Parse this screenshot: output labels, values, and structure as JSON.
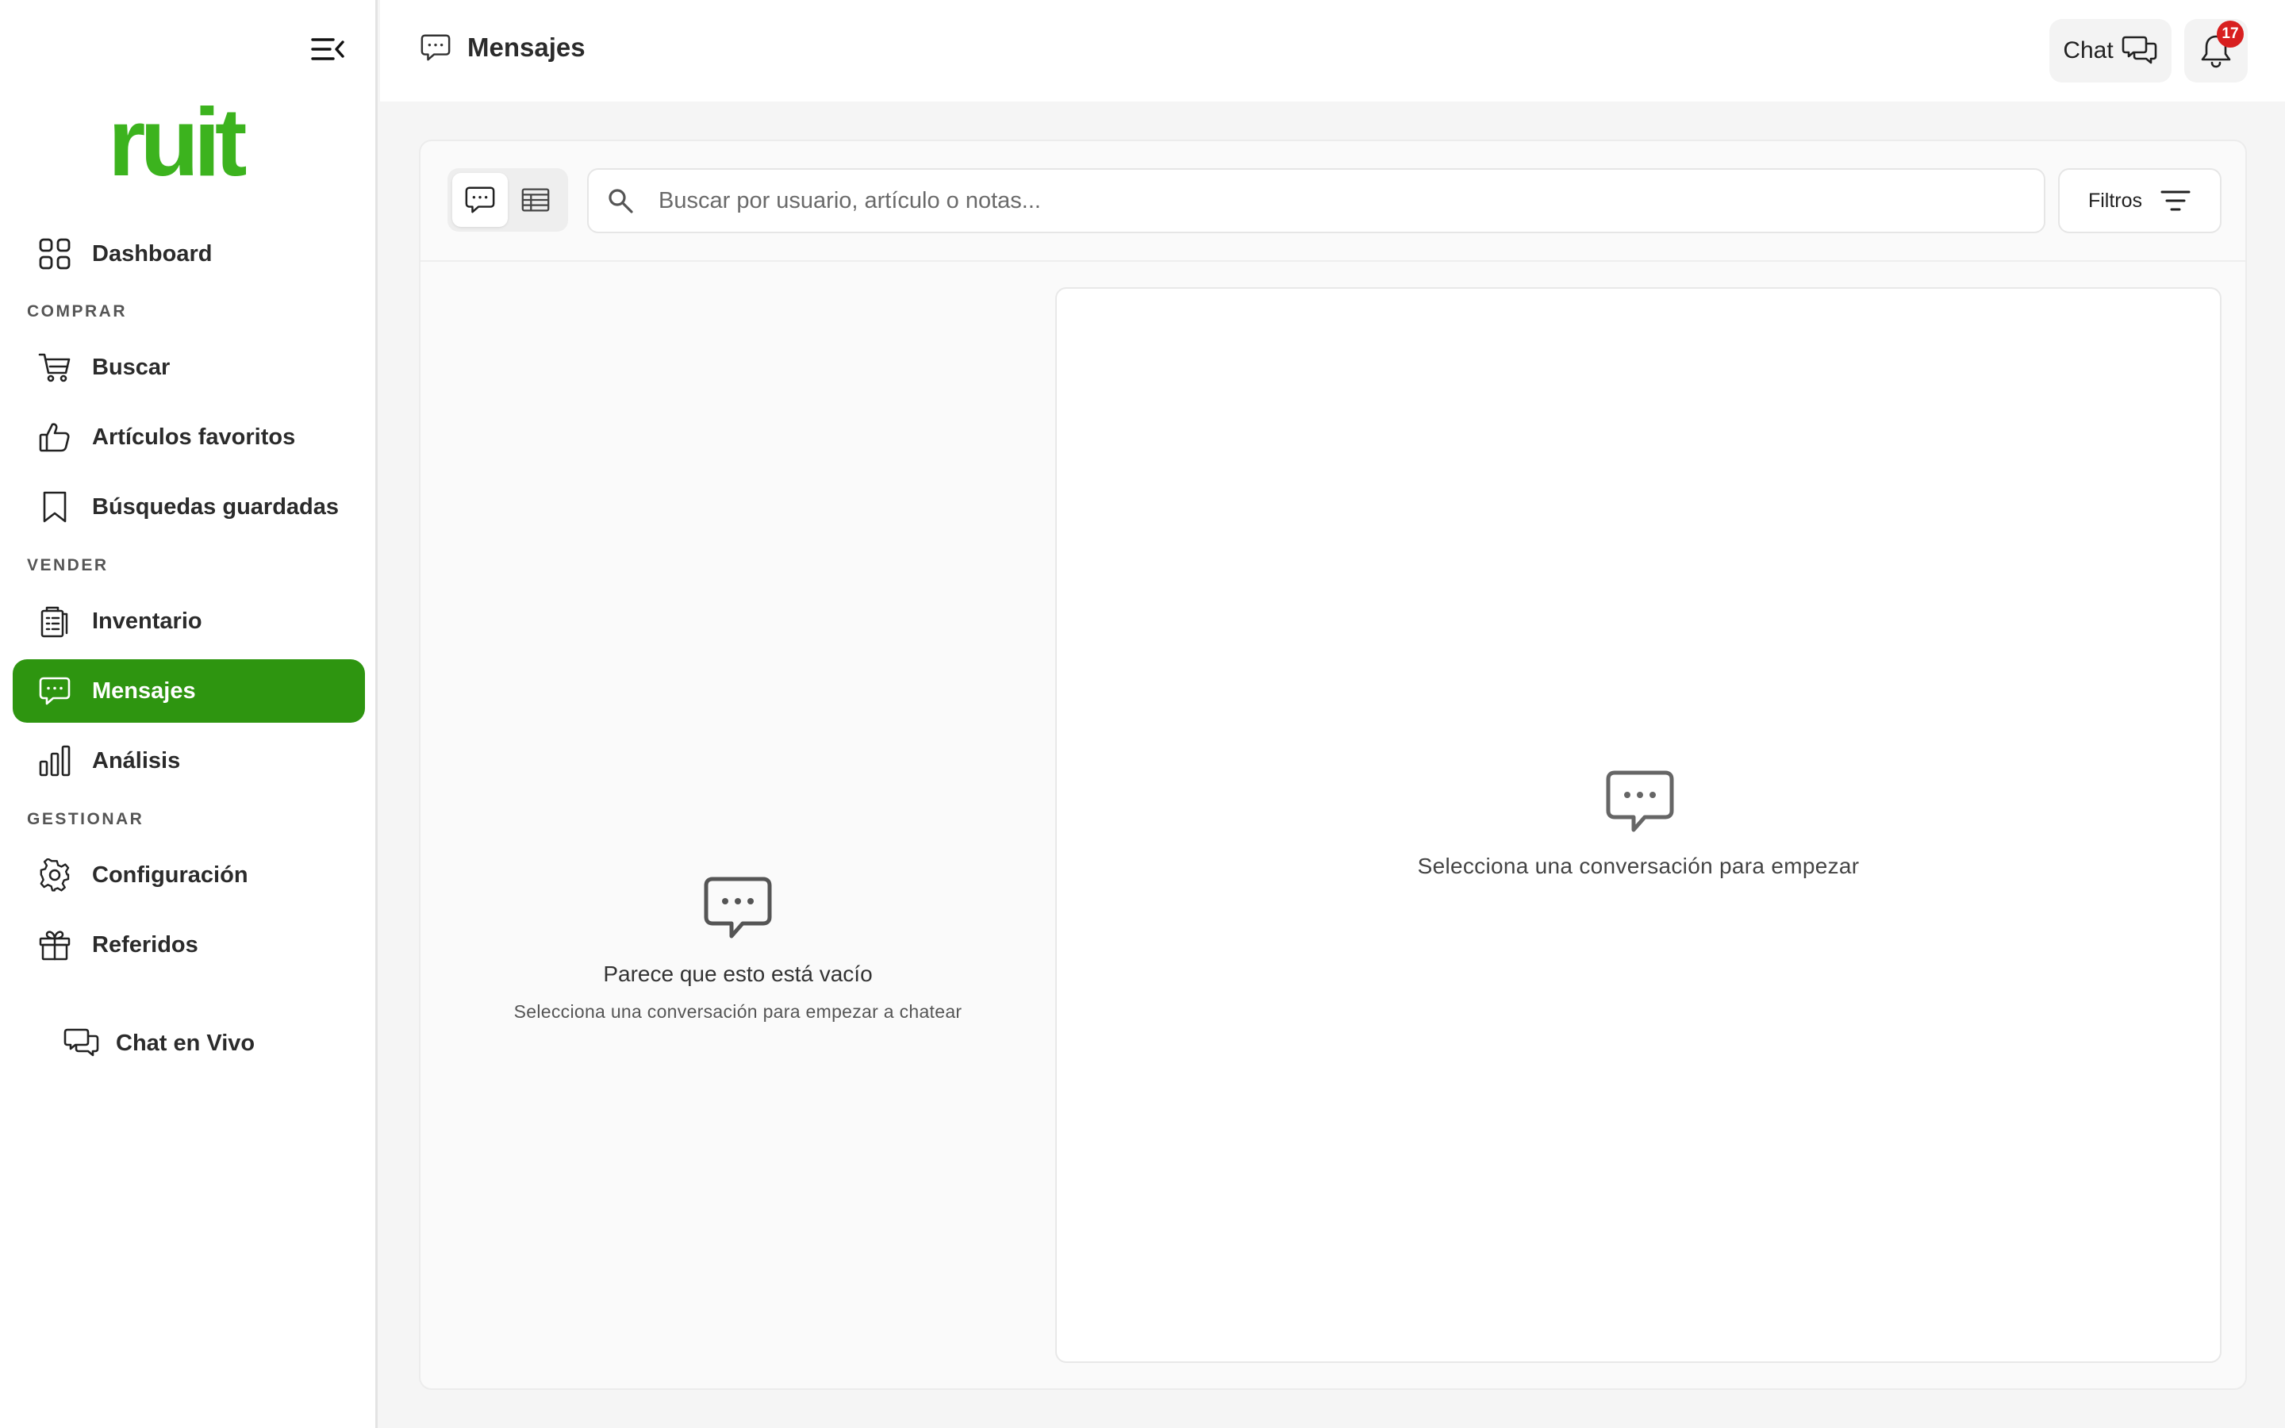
{
  "brand": {
    "logo_text": "ruit",
    "accent_color": "#2e9510",
    "logo_color": "#3cb31e"
  },
  "sidebar": {
    "collapse_icon": "collapse-menu-icon",
    "items": [
      {
        "label": "Dashboard",
        "icon": "grid-icon"
      },
      {
        "label": "Buscar",
        "icon": "cart-icon"
      },
      {
        "label": "Artículos favoritos",
        "icon": "thumbs-up-icon"
      },
      {
        "label": "Búsquedas guardadas",
        "icon": "bookmark-icon"
      },
      {
        "label": "Inventario",
        "icon": "clipboard-icon"
      },
      {
        "label": "Mensajes",
        "icon": "message-icon",
        "active": true
      },
      {
        "label": "Análisis",
        "icon": "bar-chart-icon"
      },
      {
        "label": "Configuración",
        "icon": "gear-icon"
      },
      {
        "label": "Referidos",
        "icon": "gift-icon"
      }
    ],
    "sections": {
      "comprar": "COMPRAR",
      "vender": "VENDER",
      "gestionar": "GESTIONAR"
    },
    "live_chat": {
      "label": "Chat en Vivo",
      "icon": "chat-bubbles-icon"
    }
  },
  "header": {
    "title": "Mensajes",
    "title_icon": "message-icon",
    "chat_button": {
      "label": "Chat",
      "icon": "chat-bubbles-icon"
    },
    "notifications": {
      "icon": "bell-icon",
      "count": "17",
      "badge_color": "#d81f1f"
    }
  },
  "messages": {
    "view_modes": [
      {
        "name": "chat-view",
        "icon": "message-icon",
        "selected": true
      },
      {
        "name": "table-view",
        "icon": "table-icon",
        "selected": false
      }
    ],
    "search": {
      "placeholder": "Buscar por usuario, artículo o notas...",
      "value": ""
    },
    "filter_button": {
      "label": "Filtros",
      "icon": "filter-icon"
    },
    "empty_list": {
      "title": "Parece que esto está vacío",
      "subtitle": "Selecciona una conversación para empezar a chatear"
    },
    "conversation_placeholder": "Selecciona una conversación para empezar"
  }
}
